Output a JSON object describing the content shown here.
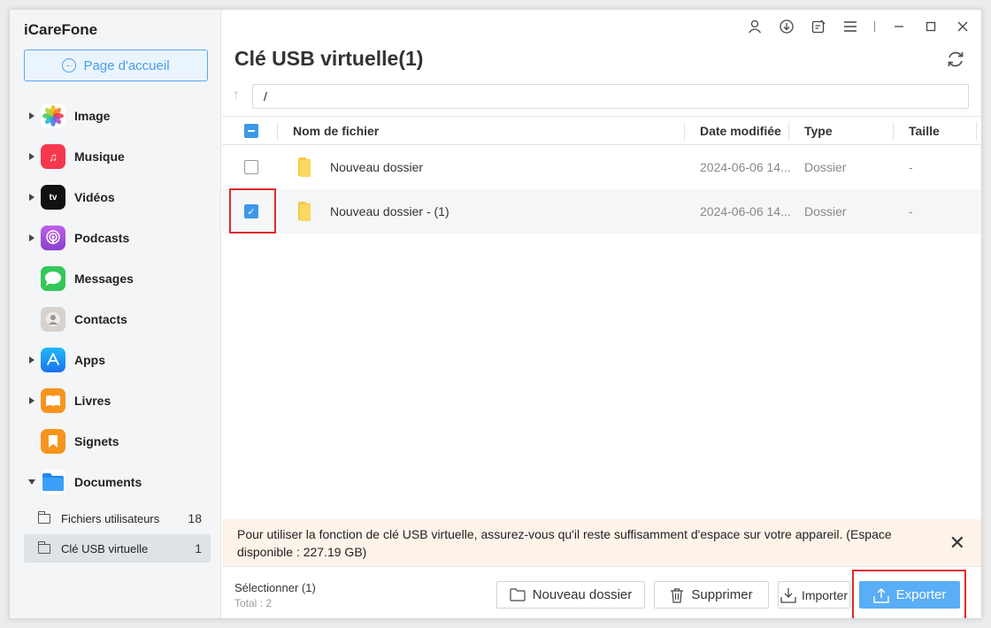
{
  "app": {
    "name": "iCareFone"
  },
  "sidebar": {
    "home_label": "Page d'accueil",
    "items": [
      {
        "label": "Image",
        "icon": "photos-icon",
        "expandable": true,
        "color": "#ffffff"
      },
      {
        "label": "Musique",
        "icon": "music-icon",
        "expandable": true,
        "color": "#f5384e"
      },
      {
        "label": "Vidéos",
        "icon": "appletv-icon",
        "expandable": true,
        "color": "#111111"
      },
      {
        "label": "Podcasts",
        "icon": "podcasts-icon",
        "expandable": true,
        "color": "#9b4fd6"
      },
      {
        "label": "Messages",
        "icon": "messages-icon",
        "expandable": false,
        "color": "#35c759"
      },
      {
        "label": "Contacts",
        "icon": "contacts-icon",
        "expandable": false,
        "color": "#d4d0cc"
      },
      {
        "label": "Apps",
        "icon": "appstore-icon",
        "expandable": true,
        "color": "#2d8cf5"
      },
      {
        "label": "Livres",
        "icon": "books-icon",
        "expandable": true,
        "color": "#f7941d"
      },
      {
        "label": "Signets",
        "icon": "bookmarks-icon",
        "expandable": false,
        "color": "#f7941d"
      },
      {
        "label": "Documents",
        "icon": "files-icon",
        "expandable": true,
        "expanded": true,
        "color": "#1e88f0"
      }
    ],
    "sub_items": [
      {
        "label": "Fichiers utilisateurs",
        "count": "18"
      },
      {
        "label": "Clé USB virtuelle",
        "count": "1",
        "active": true
      }
    ]
  },
  "main": {
    "title": "Clé USB virtuelle(1)",
    "path": "/",
    "columns": {
      "name": "Nom de fichier",
      "date": "Date modifiée",
      "type": "Type",
      "size": "Taille"
    },
    "rows": [
      {
        "name": "Nouveau dossier",
        "date": "2024-06-06 14...",
        "type": "Dossier",
        "size": "-",
        "checked": false
      },
      {
        "name": "Nouveau dossier - (1)",
        "date": "2024-06-06 14...",
        "type": "Dossier",
        "size": "-",
        "checked": true
      }
    ],
    "info": "Pour utiliser la fonction de clé USB virtuelle, assurez-vous qu'il reste suffisamment d'espace sur votre appareil. (Espace disponible : 227.19 GB)",
    "footer": {
      "selected": "Sélectionner (1)",
      "total": "Total : 2",
      "new_folder": "Nouveau dossier",
      "delete": "Supprimer",
      "import": "Importer",
      "export": "Exporter"
    }
  },
  "colors": {
    "accent": "#3b99e8",
    "highlight": "#e02a2a",
    "info_bg": "#fdf3e9"
  }
}
